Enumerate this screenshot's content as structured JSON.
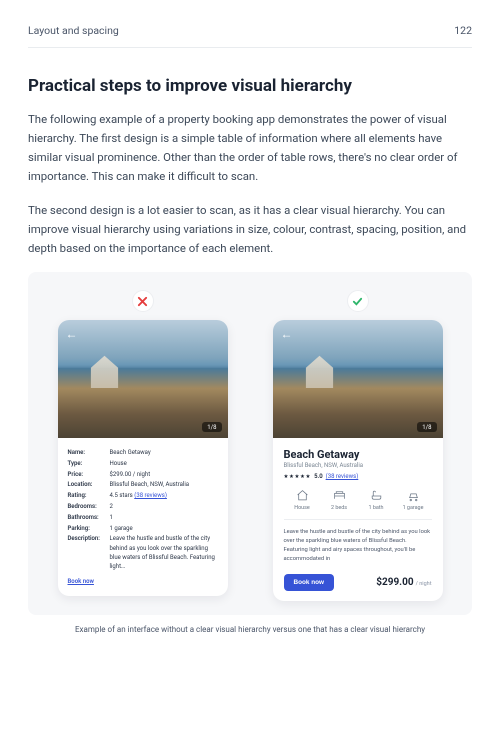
{
  "header": {
    "chapter": "Layout and spacing",
    "page": "122"
  },
  "section": {
    "title": "Practical steps to improve visual hierarchy",
    "para1": "The following example of a property booking app demonstrates the power of visual hierarchy. The first design is a simple table of information where all elements have similar visual prominence. Other than the order of table rows, there's no clear order of importance. This can make it difficult to scan.",
    "para2": "The second design is a lot easier to scan, as it has a clear visual hierarchy. You can improve visual hierarchy using variations in size, colour, contrast, spacing, position, and depth based on the importance of each element."
  },
  "example": {
    "photo_counter": "1/8",
    "bad": {
      "rows": {
        "name_k": "Name:",
        "name_v": "Beach Getaway",
        "type_k": "Type:",
        "type_v": "House",
        "price_k": "Price:",
        "price_v": "$299.00 / night",
        "location_k": "Location:",
        "location_v": "Blissful Beach, NSW, Australia",
        "rating_k": "Rating:",
        "rating_v": "4.5 stars  ",
        "rating_link": "(38 reviews)",
        "bedrooms_k": "Bedrooms:",
        "bedrooms_v": "2",
        "bathrooms_k": "Bathrooms:",
        "bathrooms_v": "1",
        "parking_k": "Parking:",
        "parking_v": "1 garage",
        "desc_k": "Description:",
        "desc_v": "Leave the hustle and bustle of the city behind as you look over the sparkling blue waters of Blissful Beach. Featuring light…"
      },
      "book": "Book now"
    },
    "good": {
      "title": "Beach Getaway",
      "location": "Blissful Beach, NSW, Australia",
      "stars": "★★★★★",
      "rating": "5.0",
      "reviews": "(38 reviews)",
      "amenities": {
        "house": "House",
        "beds": "2 beds",
        "bath": "1 bath",
        "garage": "1 garage"
      },
      "desc": "Leave the hustle and bustle of the city behind as you look over the sparkling blue waters of Blissful Beach. Featuring light and airy spaces throughout, you'll be accommodated in",
      "book": "Book now",
      "price": "$299.00",
      "price_unit": "/ night"
    },
    "caption": "Example of an interface without a clear visual hierarchy versus one that has a clear visual hierarchy"
  }
}
